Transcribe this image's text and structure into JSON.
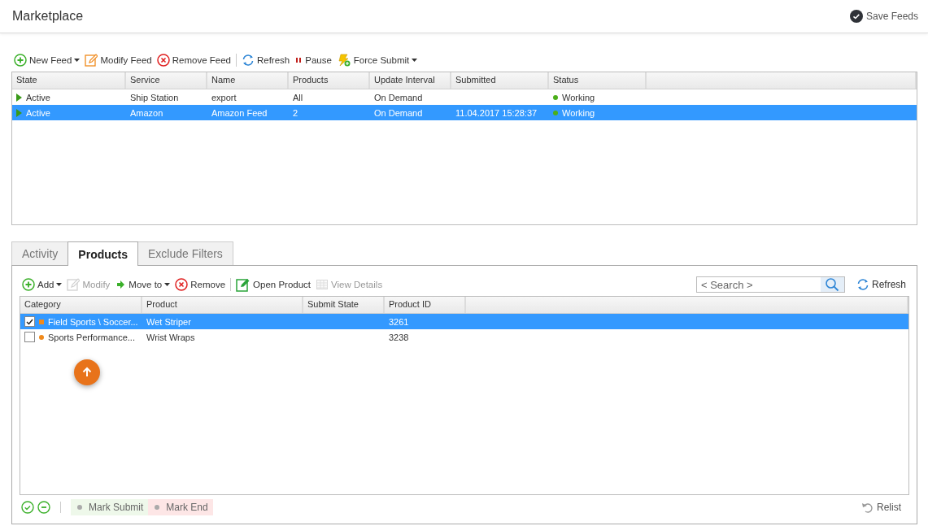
{
  "header": {
    "title": "Marketplace",
    "save_button": "Save Feeds"
  },
  "feeds": {
    "toolbar": [
      {
        "label": "New Feed",
        "kind": "dropdown",
        "disabled": false
      },
      {
        "label": "Modify Feed",
        "kind": "button",
        "disabled": false
      },
      {
        "label": "Remove Feed",
        "kind": "button",
        "disabled": false
      },
      {
        "label": "Refresh",
        "kind": "button",
        "disabled": false
      },
      {
        "label": "Pause",
        "kind": "button",
        "disabled": false
      },
      {
        "label": "Force Submit",
        "kind": "dropdown",
        "disabled": false
      }
    ],
    "columns": [
      "State",
      "Service",
      "Name",
      "Products",
      "Update Interval",
      "Submitted",
      "Status"
    ],
    "rows": [
      {
        "state": "Active",
        "service": "Ship Station",
        "name": "export",
        "products": "All",
        "update_interval": "On Demand",
        "status": "Working",
        "color": "#4caf1a",
        "selected": false
      },
      {
        "state": "Active",
        "service": "Amazon",
        "name": "Amazon Feed",
        "products": "2",
        "update_interval": "On Demand",
        "submitted": "11.04.2017 15:28:37",
        "status": "Working",
        "color": "#4caf1a",
        "selected": true
      }
    ]
  },
  "tabs": [
    {
      "label": "Activity",
      "selected": false
    },
    {
      "label": "Products",
      "selected": true
    },
    {
      "label": "Exclude Filters",
      "selected": false
    }
  ],
  "products": {
    "toolbar": [
      {
        "label": "Add",
        "kind": "dropdown",
        "disabled": false
      },
      {
        "label": "Modify",
        "kind": "button",
        "disabled": true
      },
      {
        "label": "Move to",
        "kind": "dropdown",
        "disabled": false
      },
      {
        "label": "Remove",
        "kind": "button",
        "disabled": false
      },
      {
        "label": "Open Product",
        "kind": "button",
        "disabled": false
      },
      {
        "label": "View Details",
        "kind": "button",
        "disabled": true
      }
    ],
    "search": {
      "placeholder": "< Search >"
    },
    "refresh": "Refresh",
    "columns": [
      "Category",
      "Product",
      "Submit State",
      "Product ID"
    ],
    "rows": [
      {
        "checked": true,
        "color": "#f08a1c",
        "category": "Field Sports \\ Soccer...",
        "product": "Wet Striper",
        "product_id": "3261",
        "selected": true
      },
      {
        "checked": false,
        "color": "#f08a1c",
        "category": "Sports Performance...",
        "product": "Wrist Wraps",
        "product_id": "3238",
        "selected": false
      }
    ]
  },
  "footer": {
    "mark_submit": "Mark Submit",
    "mark_end": "Mark End",
    "relist": "Relist"
  }
}
